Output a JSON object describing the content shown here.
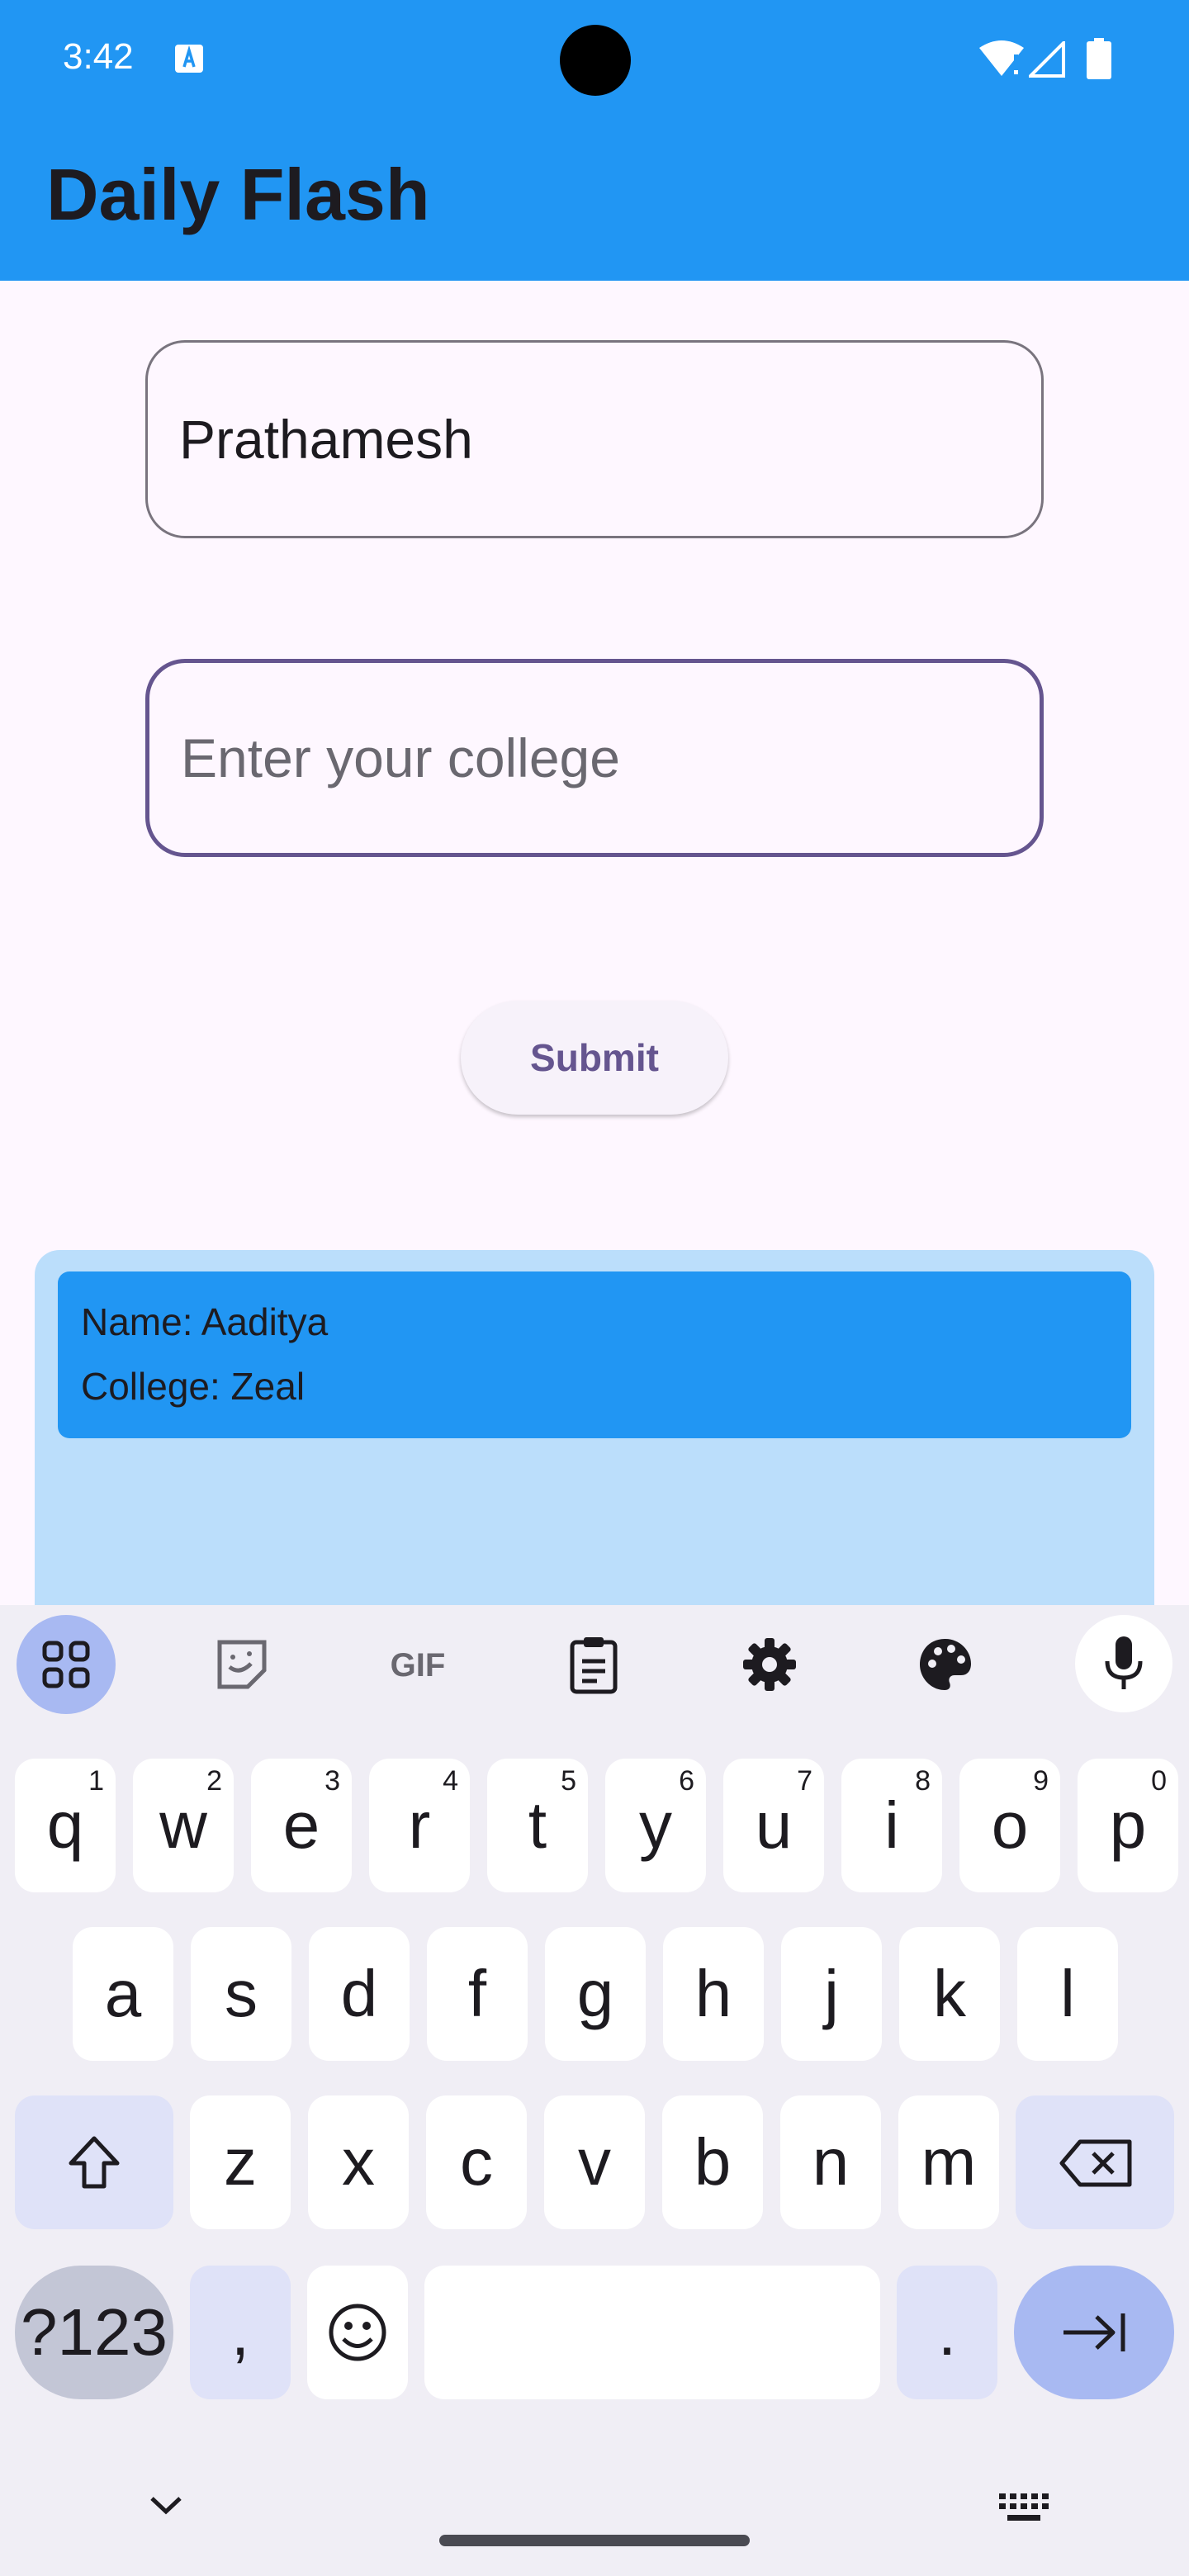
{
  "status_bar": {
    "time": "3:42"
  },
  "app_bar": {
    "title": "Daily Flash"
  },
  "form": {
    "name_value": "Prathamesh",
    "college_placeholder": "Enter your college",
    "submit_label": "Submit"
  },
  "entries": [
    {
      "name_line": "Name: Aaditya",
      "college_line": "College: Zeal"
    }
  ],
  "keyboard": {
    "row1": [
      {
        "ch": "q",
        "hint": "1"
      },
      {
        "ch": "w",
        "hint": "2"
      },
      {
        "ch": "e",
        "hint": "3"
      },
      {
        "ch": "r",
        "hint": "4"
      },
      {
        "ch": "t",
        "hint": "5"
      },
      {
        "ch": "y",
        "hint": "6"
      },
      {
        "ch": "u",
        "hint": "7"
      },
      {
        "ch": "i",
        "hint": "8"
      },
      {
        "ch": "o",
        "hint": "9"
      },
      {
        "ch": "p",
        "hint": "0"
      }
    ],
    "row2": [
      "a",
      "s",
      "d",
      "f",
      "g",
      "h",
      "j",
      "k",
      "l"
    ],
    "row3": [
      "z",
      "x",
      "c",
      "v",
      "b",
      "n",
      "m"
    ],
    "symbols_label": "?123",
    "comma_label": ",",
    "period_label": ".",
    "toolbar_icons": [
      "apps-grid-icon",
      "sticker-icon",
      "gif-icon",
      "clipboard-icon",
      "settings-icon",
      "palette-icon",
      "mic-icon"
    ]
  },
  "colors": {
    "app_bar": "#2196F3",
    "focused_border": "#65558F",
    "card_bg": "#2196F3",
    "list_bg": "#BBDEFB"
  }
}
